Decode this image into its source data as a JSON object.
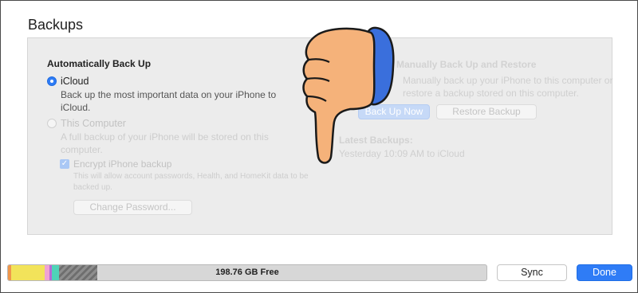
{
  "section_title": "Backups",
  "auto_backup": {
    "title": "Automatically Back Up",
    "icloud": {
      "label": "iCloud",
      "description": "Back up the most important data on your iPhone to iCloud."
    },
    "this_computer": {
      "label": "This Computer",
      "description": "A full backup of your iPhone will be stored on this computer."
    },
    "encrypt": {
      "label": "Encrypt iPhone backup",
      "description": "This will allow account passwords, Health, and HomeKit data to be backed up."
    },
    "change_password_label": "Change Password..."
  },
  "manual": {
    "title": "Manually Back Up and Restore",
    "description": "Manually back up your iPhone to this computer or restore a backup stored on this computer.",
    "backup_now_label": "Back Up Now",
    "restore_label": "Restore Backup",
    "latest_title": "Latest Backups:",
    "latest_value": "Yesterday 10:09 AM to iCloud"
  },
  "storage": {
    "free_label": "198.76 GB Free"
  },
  "footer": {
    "sync_label": "Sync",
    "done_label": "Done"
  },
  "colors": {
    "accent": "#2f7cf6",
    "thumb_fill": "#f5b27a",
    "thumb_cuff": "#3a6fdc"
  }
}
